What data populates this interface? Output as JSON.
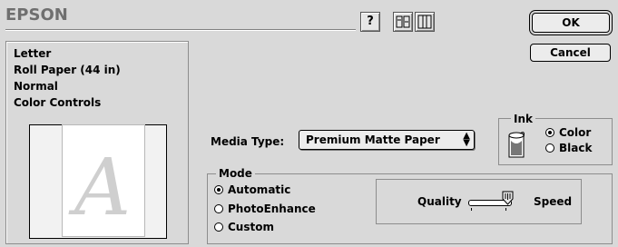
{
  "header": {
    "brand": "EPSON",
    "help_icon_glyph": "?",
    "ok_label": "OK",
    "cancel_label": "Cancel"
  },
  "summary": {
    "lines": [
      "Letter",
      "Roll Paper (44 in)",
      "Normal",
      "Color Controls"
    ],
    "preview_letter": "A"
  },
  "media_type": {
    "label": "Media Type:",
    "value": "Premium Matte Paper",
    "arrows": "▴▾"
  },
  "ink": {
    "legend": "Ink",
    "options": [
      {
        "label": "Color",
        "selected": true
      },
      {
        "label": "Black",
        "selected": false
      }
    ]
  },
  "mode": {
    "legend": "Mode",
    "options": [
      {
        "label": "Automatic",
        "selected": true
      },
      {
        "label": "PhotoEnhance",
        "selected": false
      },
      {
        "label": "Custom",
        "selected": false
      }
    ],
    "slider": {
      "left_label": "Quality",
      "right_label": "Speed",
      "level": 1.0
    }
  },
  "colors": {
    "background": "#d9d9d9",
    "brand_gray": "#6f6f6f"
  }
}
